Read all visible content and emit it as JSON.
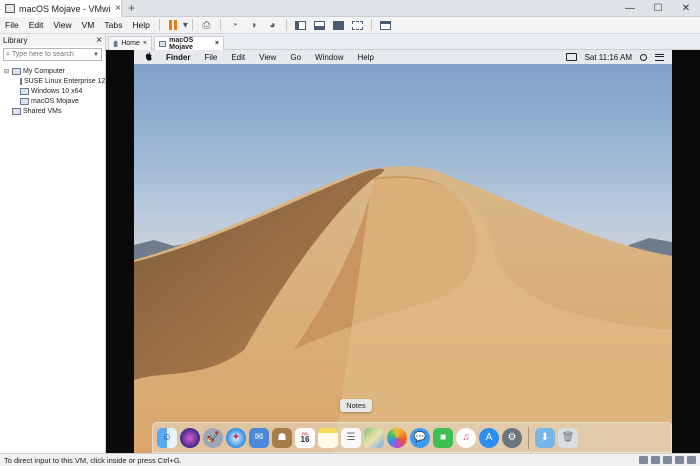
{
  "window": {
    "tab_title": "macOS Mojave - VMwi",
    "close_glyph": "×",
    "new_tab_glyph": "+",
    "controls": {
      "minimize": "—",
      "maximize": "☐",
      "close": "✕"
    }
  },
  "menu": [
    "File",
    "Edit",
    "View",
    "VM",
    "Tabs",
    "Help"
  ],
  "library": {
    "title": "Library",
    "close_glyph": "×",
    "search_placeholder": "Type here to search",
    "tree": {
      "root": "My Computer",
      "vms": [
        "SUSE Linux Enterprise 12",
        "Windows 10 x64",
        "macOS Mojave"
      ],
      "shared": "Shared VMs"
    }
  },
  "doc_tabs": {
    "home": "Home",
    "active": "macOS Mojave",
    "close_glyph": "×"
  },
  "mac": {
    "menubar": [
      "Finder",
      "File",
      "Edit",
      "View",
      "Go",
      "Window",
      "Help"
    ],
    "clock": "Sat 11:16 AM",
    "tooltip": "Notes",
    "calendar_day": "16",
    "calendar_month": "JUL",
    "dock_apps": [
      "finder-icon",
      "siri-icon",
      "launchpad-icon",
      "safari-icon",
      "mail-icon",
      "contacts-icon",
      "calendar-icon",
      "notes-icon",
      "reminders-icon",
      "maps-icon",
      "photos-icon",
      "messages-icon",
      "facetime-icon",
      "itunes-icon",
      "app-store-icon",
      "system-preferences-icon",
      "downloads-folder-icon",
      "trash-icon"
    ]
  },
  "status": {
    "text": "To direct input to this VM, click inside or press Ctrl+G."
  },
  "colors": {
    "pause_accent": "#e47d17",
    "toolbar_icon": "#4b5b72"
  }
}
